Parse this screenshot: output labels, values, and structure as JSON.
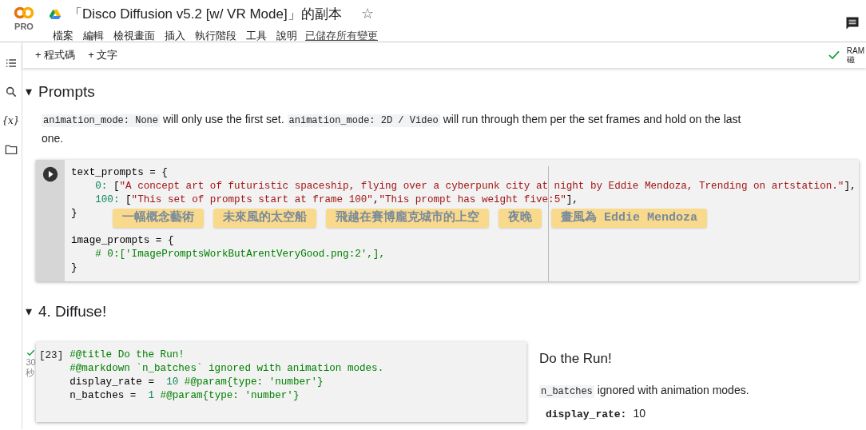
{
  "header": {
    "logo": {
      "text": "PRO"
    },
    "title": "「Disco Diffusion v5.2 [w/ VR Mode]」的副本",
    "star": "☆",
    "menus": [
      "檔案",
      "編輯",
      "檢視畫面",
      "插入",
      "執行階段",
      "工具",
      "說明"
    ],
    "save_status": "已儲存所有變更"
  },
  "toolbar": {
    "buttons": [
      {
        "icon": "+",
        "label": "程式碼"
      },
      {
        "icon": "+",
        "label": "文字"
      }
    ],
    "connected": true,
    "resources": [
      "RAM",
      "磁"
    ]
  },
  "sidebar": {
    "items": [
      {
        "kind": "list"
      },
      {
        "kind": "search"
      },
      {
        "kind": "text",
        "label": "{x}"
      },
      {
        "kind": "folder"
      }
    ]
  },
  "sections": [
    {
      "caret": "▾",
      "heading": "Prompts",
      "description": [
        {
          "kind": "code",
          "text": "animation_mode: None"
        },
        {
          "kind": "text",
          "text": " will only use the first set. "
        },
        {
          "kind": "code",
          "text": "animation_mode: 2D / Video"
        },
        {
          "kind": "text",
          "text": " will run through them per the set frames and hold on the last one."
        }
      ],
      "cells": [
        {
          "kind": "idle",
          "blocks": [
            [
              [
                {
                  "kind": "plain",
                  "text": "text_prompts = {"
                }
              ],
              [
                {
                  "kind": "number",
                  "text": "    0: "
                },
                {
                  "kind": "plain",
                  "text": "["
                },
                {
                  "kind": "string",
                  "text": "\"A concept art of futuristic spaceship, flying over a cyberpunk city at night by Eddie Mendoza, Trending on artstation.\""
                },
                {
                  "kind": "plain",
                  "text": "],"
                }
              ],
              [
                {
                  "kind": "number",
                  "text": "    100: "
                },
                {
                  "kind": "plain",
                  "text": "["
                },
                {
                  "kind": "string",
                  "text": "\"This set of prompts start at frame 100\""
                },
                {
                  "kind": "plain",
                  "text": ","
                },
                {
                  "kind": "string",
                  "text": "\"This prompt has weight five:5\""
                },
                {
                  "kind": "plain",
                  "text": "],"
                }
              ],
              [
                {
                  "kind": "plain",
                  "text": "}"
                }
              ]
            ],
            [
              [
                {
                  "kind": "plain",
                  "text": "image_prompts = {"
                }
              ],
              [
                {
                  "kind": "comment",
                  "text": "    # 0:['ImagePromptsWorkButArentVeryGood.png:2',],"
                }
              ],
              [
                {
                  "kind": "plain",
                  "text": "}"
                }
              ]
            ]
          ],
          "overlay_captions": [
            "一幅概念藝術",
            "未來風的太空船",
            "飛越在賽博龐克城市的上空",
            "夜晚",
            "畫風為 Eddie Mendoza"
          ]
        }
      ]
    },
    {
      "caret": "▾",
      "heading": "4. Diffuse!",
      "cells": [
        {
          "kind": "executed",
          "execution_count": "[23]",
          "succeeded": true,
          "duration": "30\n秒",
          "blocks": [
            [
              [
                {
                  "kind": "comment",
                  "text": "#@title Do the Run!"
                }
              ],
              [
                {
                  "kind": "comment",
                  "text": "#@markdown `n_batches` ignored with animation modes."
                }
              ],
              [
                {
                  "kind": "plain",
                  "text": "display_rate = "
                },
                {
                  "kind": "number",
                  "text": " 10"
                },
                {
                  "kind": "comment",
                  "text": " #@param{type: 'number'}"
                }
              ],
              [
                {
                  "kind": "plain",
                  "text": "n_batches = "
                },
                {
                  "kind": "number",
                  "text": " 1"
                },
                {
                  "kind": "comment",
                  "text": " #@param{type: 'number'}"
                }
              ]
            ]
          ],
          "form": {
            "title": "Do the Run!",
            "note_code": "n_batches",
            "note": " ignored with animation modes.",
            "params": [
              {
                "name": "display_rate:",
                "value": "10"
              }
            ]
          }
        }
      ]
    }
  ]
}
